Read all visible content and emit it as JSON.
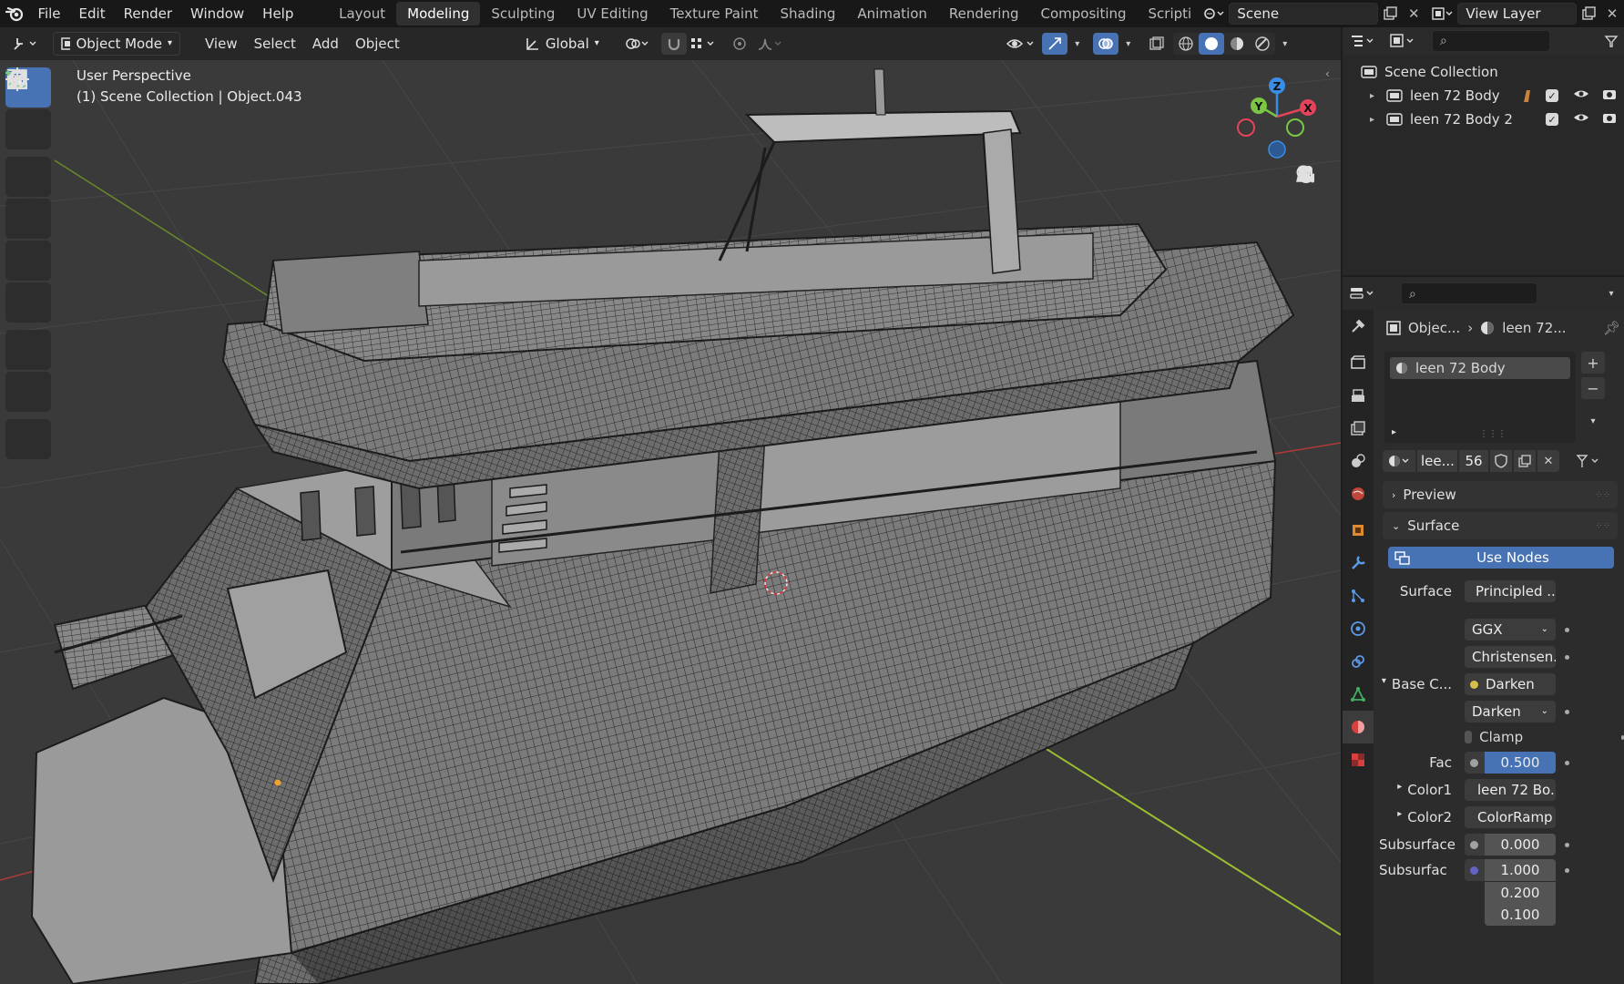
{
  "topbar": {
    "menus": [
      "File",
      "Edit",
      "Render",
      "Window",
      "Help"
    ],
    "workspaces": [
      "Layout",
      "Modeling",
      "Sculpting",
      "UV Editing",
      "Texture Paint",
      "Shading",
      "Animation",
      "Rendering",
      "Compositing",
      "Scripti"
    ],
    "active_workspace": "Modeling",
    "scene": "Scene",
    "view_layer": "View Layer"
  },
  "viewport_header": {
    "mode": "Object Mode",
    "menus": [
      "View",
      "Select",
      "Add",
      "Object"
    ],
    "orientation": "Global"
  },
  "viewport": {
    "perspective": "User Perspective",
    "collection_info": "(1) Scene Collection | Object.043",
    "gizmo": {
      "x": "X",
      "y": "Y",
      "z": "Z"
    }
  },
  "outliner": {
    "root": "Scene Collection",
    "items": [
      {
        "label": "leen 72 Body"
      },
      {
        "label": "leen 72 Body 2"
      }
    ]
  },
  "properties": {
    "breadcrumb_object": "Objec...",
    "breadcrumb_material": "leen 72...",
    "material_slot": "leen 72 Body",
    "material_name": "lee...",
    "user_count": "56",
    "panels": {
      "preview": "Preview",
      "surface": "Surface"
    },
    "use_nodes": "Use Nodes",
    "rows": {
      "surface_label": "Surface",
      "surface_value": "Principled ...",
      "distribution": "GGX",
      "subsurface_method": "Christensen...",
      "base_color_label": "Base C...",
      "base_color_value": "Darken",
      "blend_mode": "Darken",
      "clamp": "Clamp",
      "fac_label": "Fac",
      "fac_value": "0.500",
      "color1_label": "Color1",
      "color1_value": "leen 72 Bo...",
      "color2_label": "Color2",
      "color2_value": "ColorRamp",
      "subsurface_label": "Subsurface",
      "subsurface_value": "0.000",
      "subsurface_radius_label": "Subsurfac",
      "subsurface_radius_values": [
        "1.000",
        "0.200",
        "0.100"
      ]
    }
  },
  "colors": {
    "accent": "#4772b3",
    "x_axis": "#e3445b",
    "y_axis": "#7bc744",
    "z_axis": "#3a8ee6",
    "socket_yellow": "#d5c14a",
    "socket_green": "#5fc35a",
    "socket_grey": "#a1a1a1",
    "socket_purple": "#6363c7"
  }
}
